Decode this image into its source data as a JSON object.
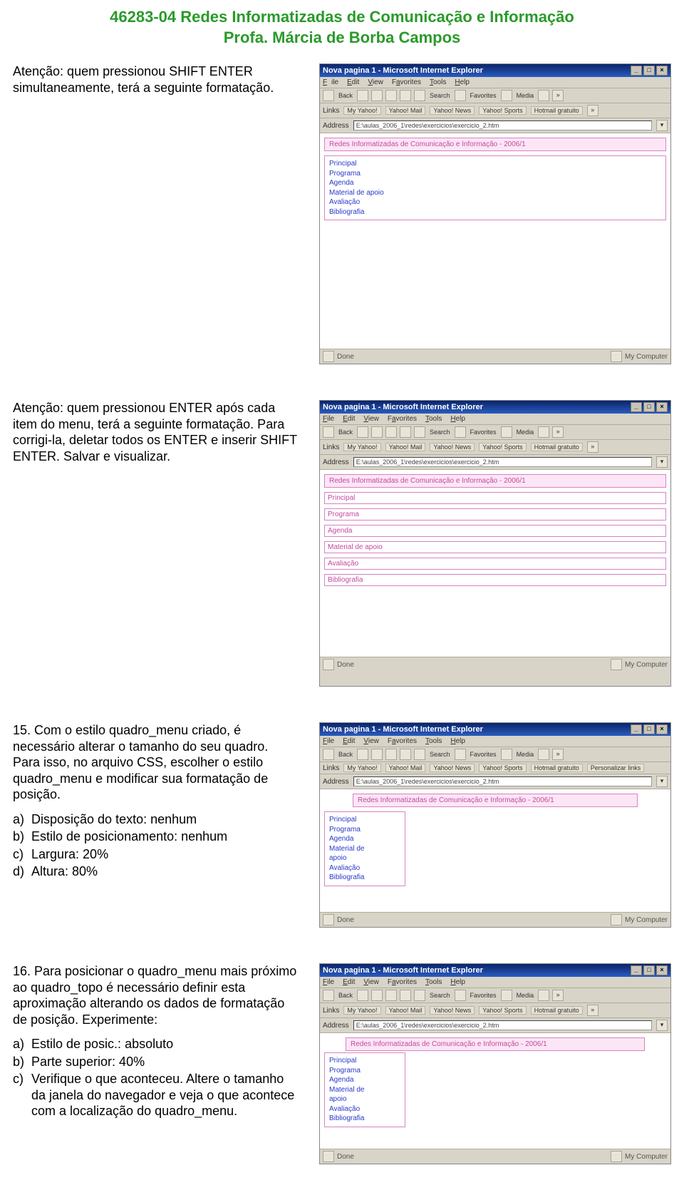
{
  "header": {
    "title": "46283-04 Redes Informatizadas de Comunicação e Informação",
    "subtitle": "Profa. Márcia de Borba Campos"
  },
  "sec1": {
    "p1": "Atenção: quem pressionou SHIFT ENTER simultaneamente, terá a seguinte formatação."
  },
  "sec2": {
    "p1": "Atenção: quem pressionou ENTER após cada item do menu, terá a seguinte formatação. Para corrigi-la, deletar todos os ENTER e inserir SHIFT ENTER. Salvar e visualizar."
  },
  "sec3": {
    "p1": "15. Com o estilo quadro_menu criado, é necessário alterar o tamanho do seu quadro. Para isso, no arquivo CSS, escolher o estilo quadro_menu e modificar sua formatação de posição.",
    "items": {
      "a": "Disposição do texto: nenhum",
      "b": "Estilo de posicionamento: nenhum",
      "c": "Largura: 20%",
      "d": "Altura: 80%"
    }
  },
  "sec4": {
    "p1": "16. Para posicionar o quadro_menu mais próximo ao quadro_topo é necessário definir esta aproximação alterando os dados de formatação de posição. Experimente:",
    "items": {
      "a": "Estilo de posic.: absoluto",
      "b": "Parte superior: 40%",
      "c": "Verifique o que aconteceu. Altere o tamanho da janela do navegador e veja o que acontece com a localização do quadro_menu."
    }
  },
  "ie_common": {
    "title": "Nova pagina 1 - Microsoft Internet Explorer",
    "menu": {
      "file": "File",
      "edit": "Edit",
      "view": "View",
      "favorites": "Favorites",
      "tools": "Tools",
      "help": "Help"
    },
    "toolbar": {
      "back": "Back",
      "search": "Search",
      "favorites": "Favorites",
      "media": "Media"
    },
    "links_label": "Links",
    "links": [
      "My Yahoo!",
      "Yahoo! Mail",
      "Yahoo! News",
      "Yahoo! Sports",
      "Hotmail gratuito"
    ],
    "links_extra": "Personalizar links",
    "addr_label": "Address",
    "addr_value": "E:\\aulas_2006_1\\redes\\exercicios\\exercicio_2.htm",
    "status_done": "Done",
    "status_right": "My Computer",
    "banner": "Redes Informatizadas de Comunicação e Informação - 2006/1",
    "menu_items": [
      "Principal",
      "Programa",
      "Agenda",
      "Material de apoio",
      "Avaliação",
      "Bibliografia"
    ],
    "menu_items_wrapped": [
      "Principal",
      "Programa",
      "Agenda",
      "Material de",
      "apoio",
      "Avaliação",
      "Bibliografia"
    ]
  }
}
